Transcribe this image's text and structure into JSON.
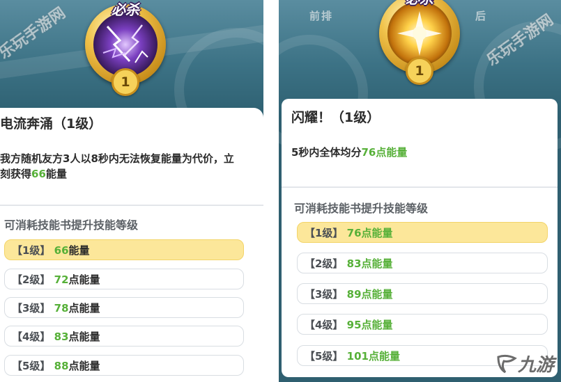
{
  "watermark": "乐玩手游网",
  "logo": "九游",
  "left": {
    "skill_tag": "必杀",
    "level": "1",
    "title": "电流奔涌（1级）",
    "desc_pre": "我方随机友方3人以8秒内无法恢复能量为代价，立刻获得",
    "desc_value": "66",
    "desc_post": "能量",
    "section_label": "可消耗技能书提升技能等级",
    "levels": [
      {
        "label": "【1级】",
        "value": "66",
        "unit": "能量"
      },
      {
        "label": "【2级】",
        "value": "72",
        "unit": "点能量"
      },
      {
        "label": "【3级】",
        "value": "78",
        "unit": "点能量"
      },
      {
        "label": "【4级】",
        "value": "83",
        "unit": "点能量"
      },
      {
        "label": "【5级】",
        "value": "88",
        "unit": "点能量"
      }
    ]
  },
  "right": {
    "tab_front": "前排",
    "tab_back": "后",
    "skill_tag": "必杀",
    "level": "1",
    "title": "闪耀！（1级）",
    "desc_pre": "5秒内全体均分",
    "desc_value": "76点能量",
    "section_label": "可消耗技能书提升技能等级",
    "levels": [
      {
        "label": "【1级】",
        "value": "76",
        "unit": "点能量"
      },
      {
        "label": "【2级】",
        "value": "83",
        "unit": "点能量"
      },
      {
        "label": "【3级】",
        "value": "89",
        "unit": "点能量"
      },
      {
        "label": "【4级】",
        "value": "95",
        "unit": "点能量"
      },
      {
        "label": "【5级】",
        "value": "101",
        "unit": "点能量"
      }
    ]
  }
}
